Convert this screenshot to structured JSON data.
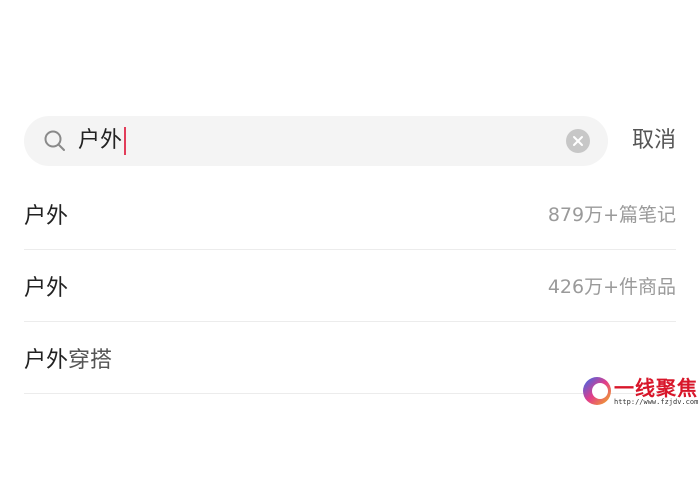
{
  "search": {
    "query": "户外",
    "icon": "search-icon",
    "clear_icon": "clear-icon",
    "cancel_label": "取消"
  },
  "suggestions": [
    {
      "match": "户外",
      "rest": "",
      "meta": "879万+篇笔记"
    },
    {
      "match": "户外",
      "rest": "",
      "meta": "426万+件商品"
    },
    {
      "match": "户外",
      "rest": "穿搭",
      "meta": ""
    }
  ],
  "watermark": {
    "text": "一线聚焦",
    "url": "http://www.fzjdv.com"
  },
  "colors": {
    "caret": "#e23d5a",
    "search_bg": "#f4f4f4",
    "watermark_red": "#d8162a"
  }
}
